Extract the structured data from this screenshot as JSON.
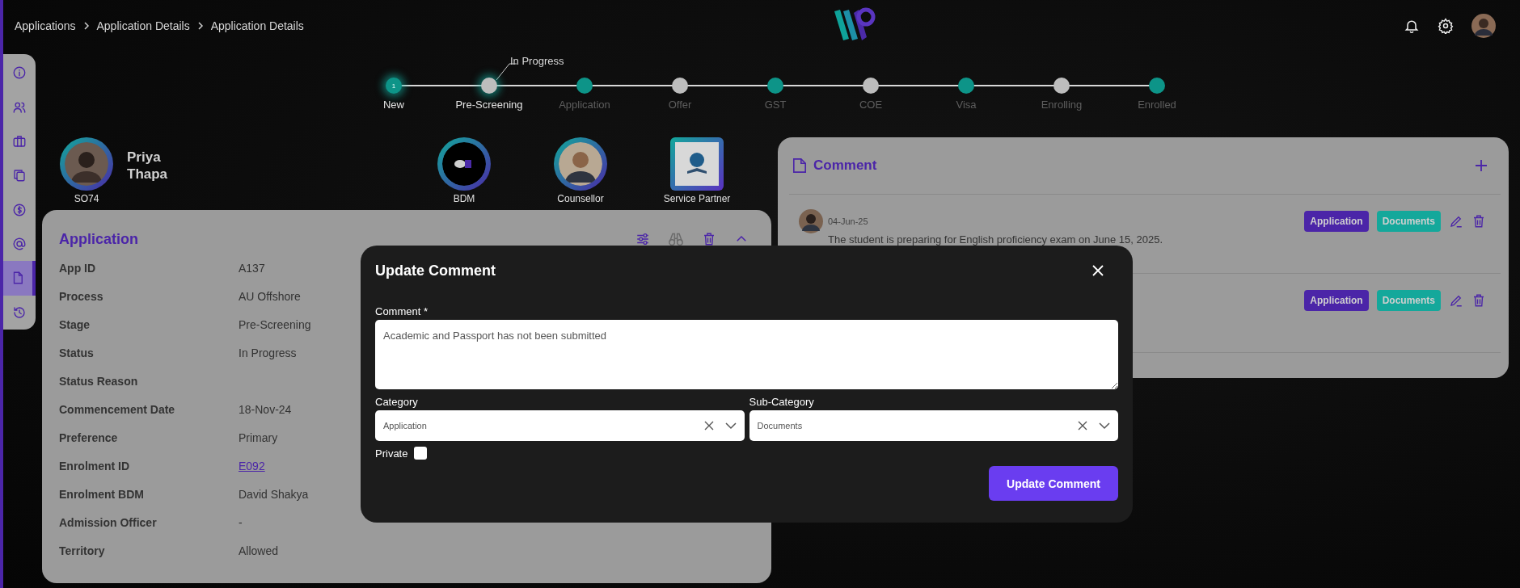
{
  "breadcrumb": [
    "Applications",
    "Application Details",
    "Application Details"
  ],
  "sidebar": {
    "items": [
      {
        "selected": false
      },
      {
        "selected": false
      },
      {
        "selected": false
      },
      {
        "selected": false
      },
      {
        "selected": false
      },
      {
        "selected": false
      },
      {
        "selected": true
      },
      {
        "selected": false
      }
    ]
  },
  "stepper": {
    "current_status": "In Progress",
    "steps": [
      {
        "label": "New",
        "number": "1",
        "color": "#0d9488",
        "reached": true,
        "selected": false
      },
      {
        "label": "Pre-Screening",
        "color": "#bdbdbd",
        "reached": true,
        "selected": true
      },
      {
        "label": "Application",
        "color": "#0d9488",
        "reached": false,
        "selected": false
      },
      {
        "label": "Offer",
        "color": "#bdbdbd",
        "reached": false,
        "selected": false
      },
      {
        "label": "GST",
        "color": "#0d9488",
        "reached": false,
        "selected": false
      },
      {
        "label": "COE",
        "color": "#bdbdbd",
        "reached": false,
        "selected": false
      },
      {
        "label": "Visa",
        "color": "#0d9488",
        "reached": false,
        "selected": false
      },
      {
        "label": "Enrolling",
        "color": "#bdbdbd",
        "reached": false,
        "selected": false
      },
      {
        "label": "Enrolled",
        "color": "#0d9488",
        "reached": false,
        "selected": false
      }
    ]
  },
  "profile": {
    "name": "Priya Thapa",
    "id": "SO74"
  },
  "team": [
    {
      "role": "BDM",
      "kind": "logo"
    },
    {
      "role": "Counsellor",
      "kind": "avatar"
    },
    {
      "role": "Service Partner",
      "kind": "partner"
    }
  ],
  "application": {
    "title": "Application",
    "fields": [
      {
        "label": "App ID",
        "value": "A137"
      },
      {
        "label": "Process",
        "value": "AU Offshore"
      },
      {
        "label": "Stage",
        "value": "Pre-Screening"
      },
      {
        "label": "Status",
        "value": "In Progress"
      },
      {
        "label": "Status Reason"
      },
      {
        "label": "Commencement Date",
        "value": "18-Nov-24"
      },
      {
        "label": "Preference",
        "value": "Primary"
      },
      {
        "label": "Enrolment ID",
        "value": "E092",
        "kind": "link"
      },
      {
        "label": "Enrolment BDM",
        "value": "David Shakya"
      },
      {
        "label": "Admission Officer",
        "value": "-"
      },
      {
        "label": "Territory",
        "value": "Allowed"
      }
    ]
  },
  "comments": {
    "title": "Comment",
    "items": [
      {
        "date": "04-Jun-25",
        "text": "The student is preparing for English proficiency exam on June 15, 2025.",
        "tags": [
          {
            "label": "Application",
            "color": "#4b25a8"
          },
          {
            "label": "Documents",
            "color": "#14a89b"
          }
        ]
      },
      {
        "tags": [
          {
            "label": "Application",
            "color": "#4b25a8"
          },
          {
            "label": "Documents",
            "color": "#14a89b"
          }
        ]
      }
    ]
  },
  "modal": {
    "title": "Update Comment",
    "comment_label": "Comment *",
    "comment_value": "Academic and Passport has not been submitted",
    "category_label": "Category",
    "category_value": "Application",
    "subcategory_label": "Sub-Category",
    "subcategory_value": "Documents",
    "private_label": "Private",
    "private_checked": false,
    "submit": "Update Comment"
  }
}
